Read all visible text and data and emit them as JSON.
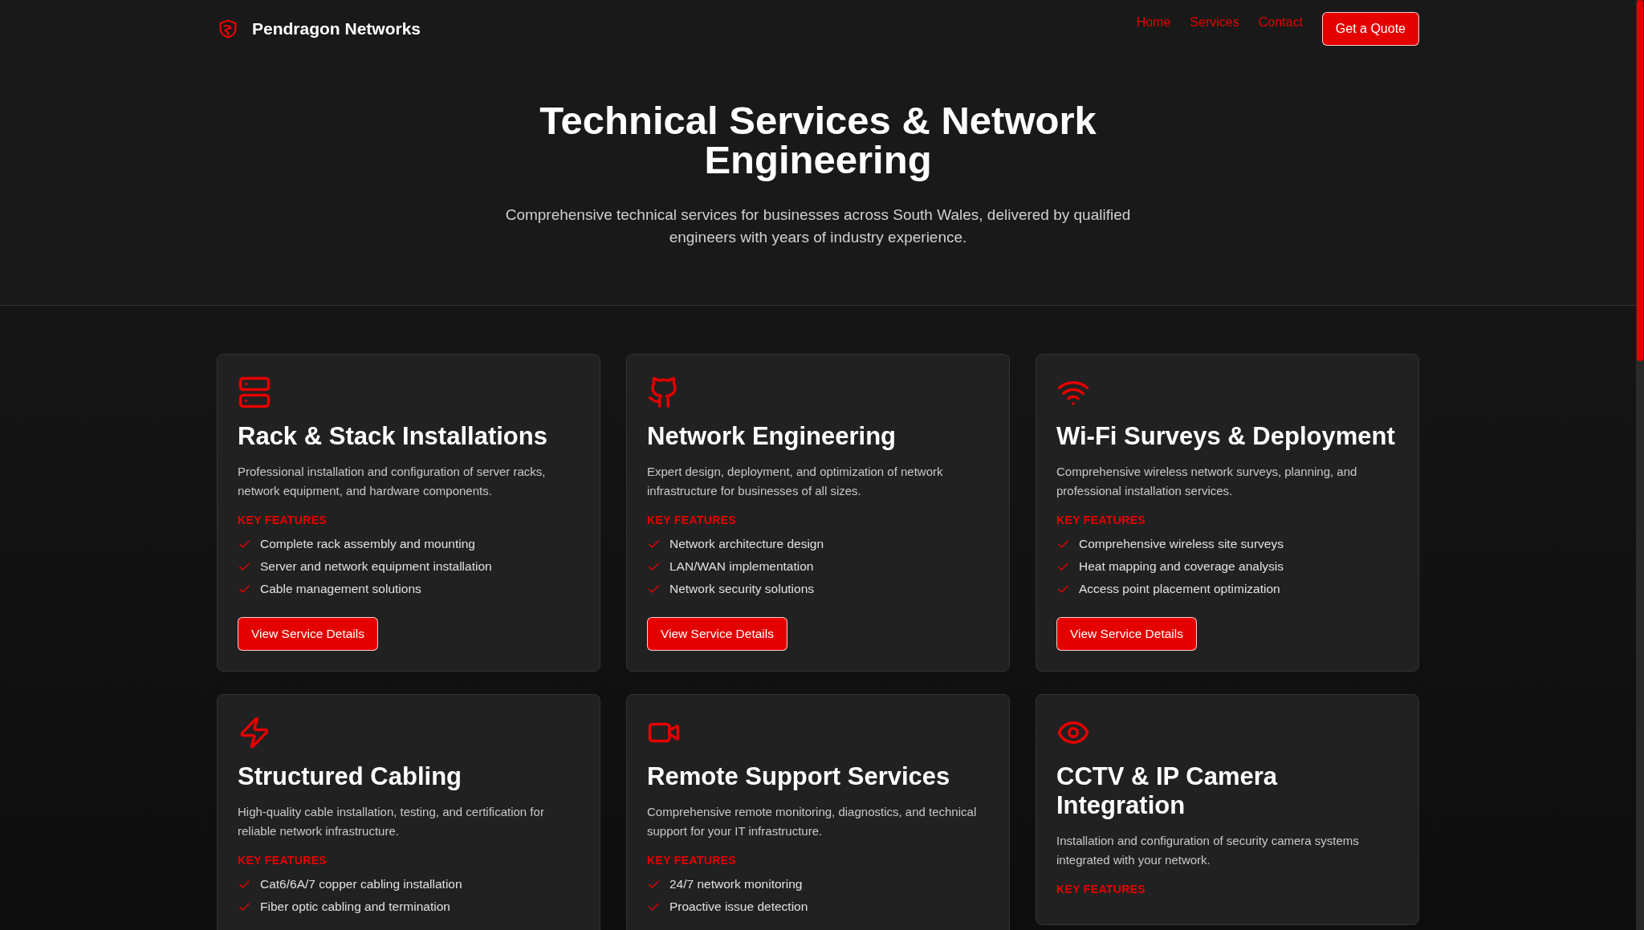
{
  "nav": {
    "brand": "Pendragon Networks",
    "links": [
      {
        "label": "Home"
      },
      {
        "label": "Services"
      },
      {
        "label": "Contact"
      }
    ],
    "cta": "Get a Quote"
  },
  "hero": {
    "title": "Technical Services & Network Engineering",
    "subtitle": "Comprehensive technical services for businesses across South Wales, delivered by qualified engineers with years of industry experience."
  },
  "services": [
    {
      "title": "Rack & Stack Installations",
      "description": "Professional installation and configuration of server racks, network equipment, and hardware components.",
      "features_heading": "KEY FEATURES",
      "features": [
        "Complete rack assembly and mounting",
        "Server and network equipment installation",
        "Cable management solutions"
      ],
      "button": "View Service Details"
    },
    {
      "title": "Network Engineering",
      "description": "Expert design, deployment, and optimization of network infrastructure for businesses of all sizes.",
      "features_heading": "KEY FEATURES",
      "features": [
        "Network architecture design",
        "LAN/WAN implementation",
        "Network security solutions"
      ],
      "button": "View Service Details"
    },
    {
      "title": "Wi-Fi Surveys & Deployment",
      "description": "Comprehensive wireless network surveys, planning, and professional installation services.",
      "features_heading": "KEY FEATURES",
      "features": [
        "Comprehensive wireless site surveys",
        "Heat mapping and coverage analysis",
        "Access point placement optimization"
      ],
      "button": "View Service Details"
    },
    {
      "title": "Structured Cabling",
      "description": "High-quality cable installation, testing, and certification for reliable network infrastructure.",
      "features_heading": "KEY FEATURES",
      "features": [
        "Cat6/6A/7 copper cabling installation",
        "Fiber optic cabling and termination"
      ]
    },
    {
      "title": "Remote Support Services",
      "description": "Comprehensive remote monitoring, diagnostics, and technical support for your IT infrastructure.",
      "features_heading": "KEY FEATURES",
      "features": [
        "24/7 network monitoring",
        "Proactive issue detection"
      ]
    },
    {
      "title": "CCTV & IP Camera Integration",
      "description": "Installation and configuration of security camera systems integrated with your network.",
      "features_heading": "KEY FEATURES"
    }
  ]
}
